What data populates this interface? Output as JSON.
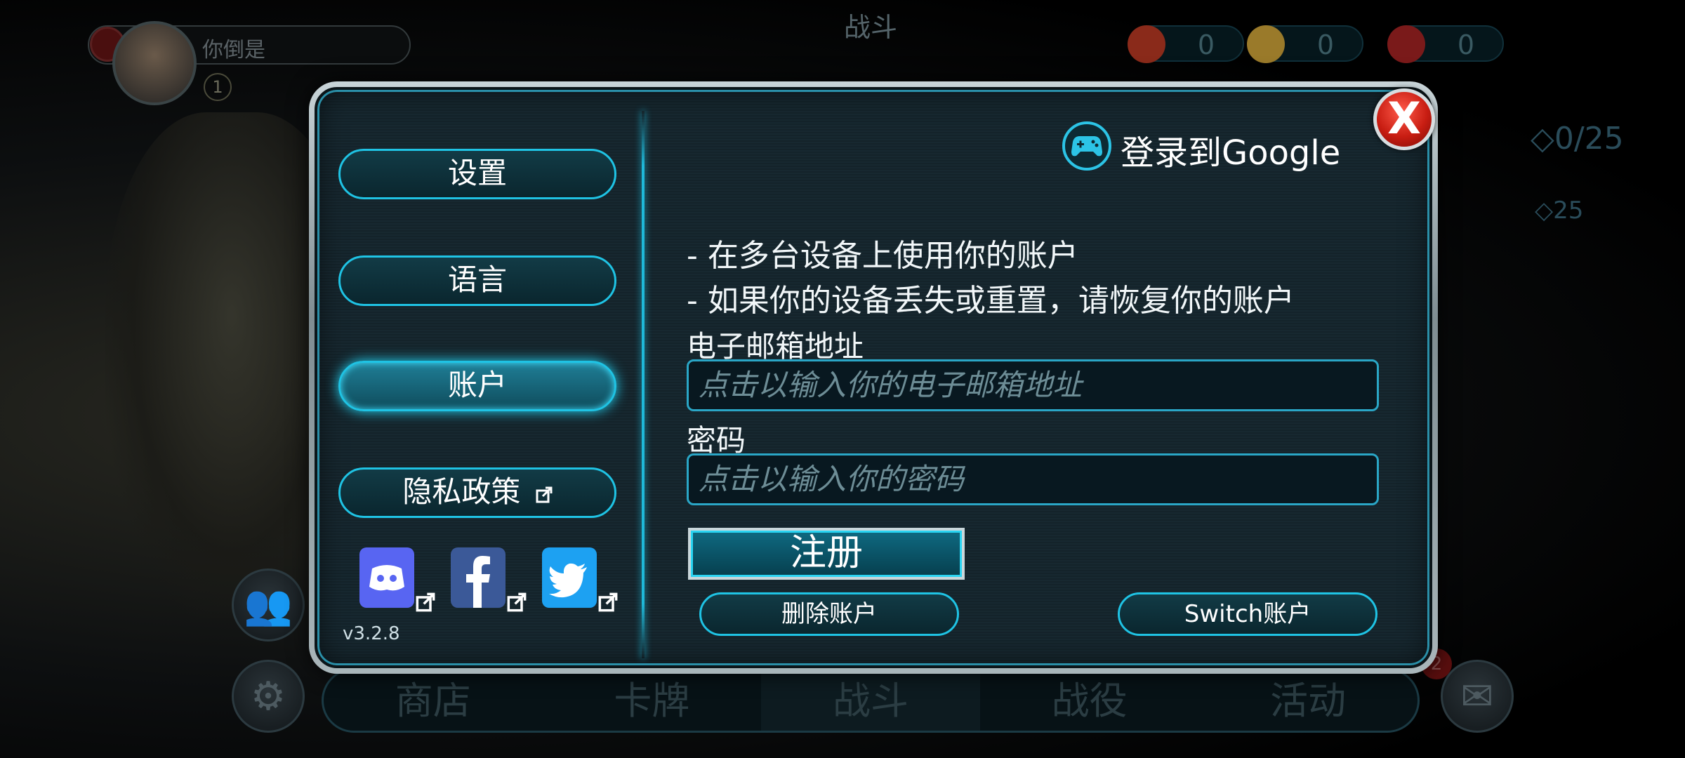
{
  "background": {
    "top_title": "战斗",
    "player_name": "你倒是",
    "player_level": "1",
    "currencies": [
      {
        "icon": "ticket-icon",
        "value": "0",
        "color": "#8a2a1a"
      },
      {
        "icon": "gold-coin-icon",
        "value": "0",
        "color": "#9a7a2a"
      },
      {
        "icon": "red-gem-icon",
        "value": "0",
        "color": "#7a1a1a"
      }
    ],
    "side_counter_main": "0/25",
    "side_counter_small": "25",
    "bottom_nav": [
      "商店",
      "卡牌",
      "战斗",
      "战役",
      "活动"
    ],
    "bottom_nav_active": "战斗",
    "notification_count": "2"
  },
  "modal": {
    "menu": [
      {
        "label": "设置",
        "selected": false
      },
      {
        "label": "语言",
        "selected": false
      },
      {
        "label": "账户",
        "selected": true
      },
      {
        "label": "隐私政策",
        "selected": false,
        "external": true
      }
    ],
    "social": [
      {
        "name": "discord",
        "icon": "discord-icon",
        "color": "#5865f2"
      },
      {
        "name": "facebook",
        "icon": "facebook-icon",
        "color": "#3b5998"
      },
      {
        "name": "twitter",
        "icon": "twitter-icon",
        "color": "#1da1f2"
      }
    ],
    "version": "v3.2.8",
    "google_login_label": "登录到Google",
    "bullets": [
      "- 在多台设备上使用你的账户",
      "- 如果你的设备丢失或重置，请恢复你的账户"
    ],
    "email_label": "电子邮箱地址",
    "email_placeholder": "点击以输入你的电子邮箱地址",
    "password_label": "密码",
    "password_placeholder": "点击以输入你的密码",
    "register_label": "注册",
    "delete_account_label": "删除账户",
    "switch_account_label": "Switch账户",
    "close_label": "X"
  }
}
